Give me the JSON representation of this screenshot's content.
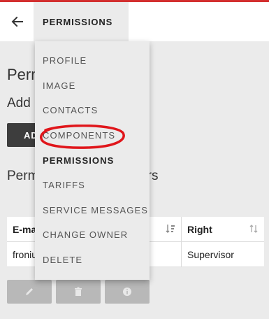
{
  "appbar": {
    "tab": "PERMISSIONS"
  },
  "page": {
    "title": "Perm",
    "add_text": "Add",
    "add_button": "AD",
    "description": "Perm                         ual Solar.web users"
  },
  "table": {
    "headers": {
      "email": "E-ma",
      "right": "Right"
    },
    "rows": [
      {
        "email": "froniu",
        "right": "Supervisor"
      }
    ]
  },
  "menu": {
    "items": [
      {
        "label": "PROFILE",
        "active": false
      },
      {
        "label": "IMAGE",
        "active": false
      },
      {
        "label": "CONTACTS",
        "active": false
      },
      {
        "label": "COMPONENTS",
        "active": false
      },
      {
        "label": "PERMISSIONS",
        "active": true
      },
      {
        "label": "TARIFFS",
        "active": false
      },
      {
        "label": "SERVICE MESSAGES",
        "active": false
      },
      {
        "label": "CHANGE OWNER",
        "active": false
      },
      {
        "label": "DELETE",
        "active": false
      }
    ]
  },
  "colors": {
    "accent": "#d32f2f",
    "annotation": "#e0161b"
  },
  "icons": {
    "back": "arrow-left-icon",
    "sort_email": "sort-alpha-icon",
    "sort_right": "sort-icon",
    "edit": "pencil-icon",
    "delete": "trash-icon",
    "info": "info-icon"
  }
}
